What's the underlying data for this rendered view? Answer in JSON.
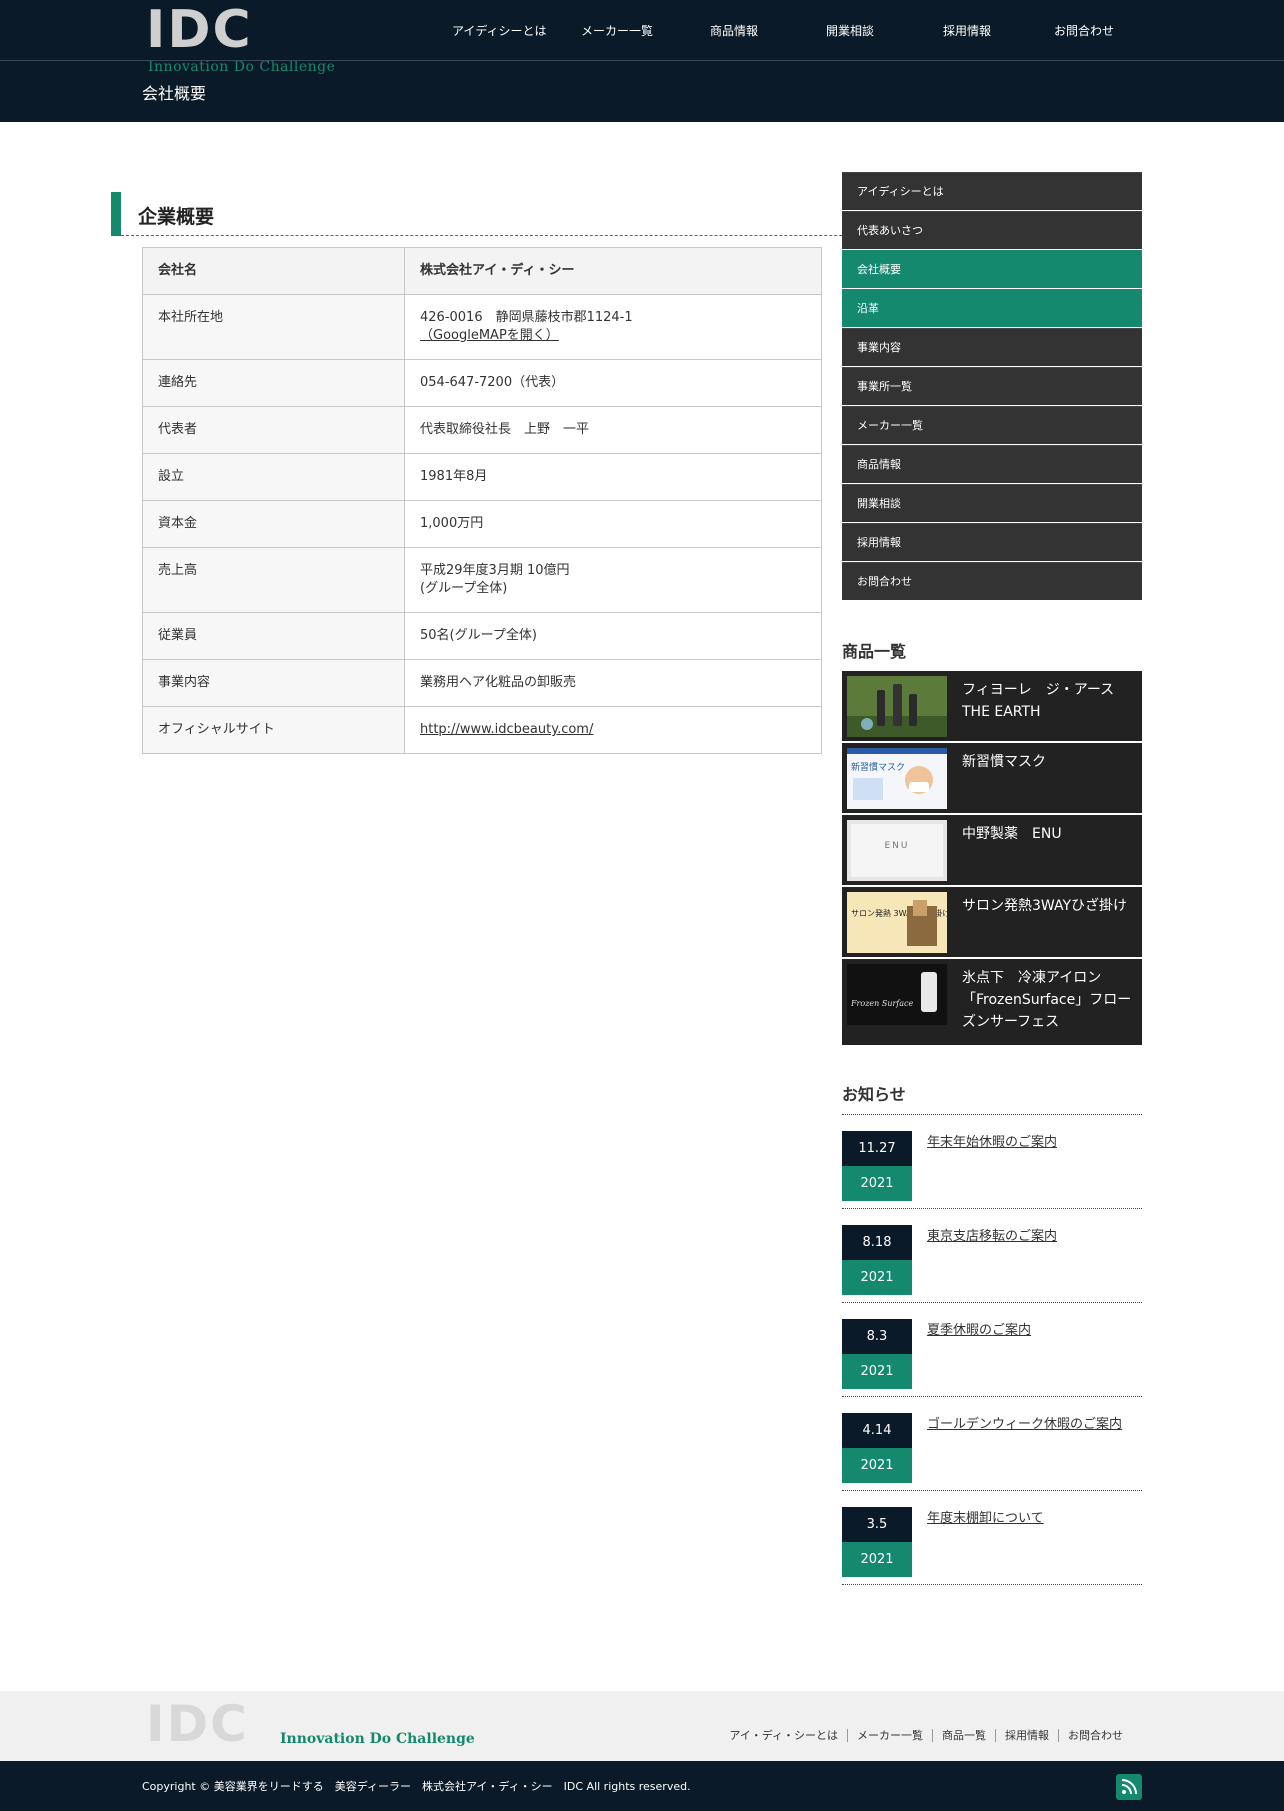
{
  "header": {
    "logo_text": "IDC",
    "logo_tagline": "Innovation Do Challenge",
    "nav": [
      "アイディシーとは",
      "メーカー一覧",
      "商品情報",
      "開業相談",
      "採用情報",
      "お問合わせ"
    ],
    "page_heading": "会社概要"
  },
  "main": {
    "section_title": "企業概要",
    "table": [
      {
        "key": "会社名",
        "value": "株式会社アイ・ディ・シー"
      },
      {
        "key": "本社所在地",
        "value": "426-0016　静岡県藤枝市郡1124-1",
        "link": "（GoogleMAPを開く）"
      },
      {
        "key": "連絡先",
        "value": "054-647-7200（代表）"
      },
      {
        "key": "代表者",
        "value": "代表取締役社長　上野　一平"
      },
      {
        "key": "設立",
        "value": "1981年8月"
      },
      {
        "key": "資本金",
        "value": "1,000万円"
      },
      {
        "key": "売上高",
        "value": "平成29年度3月期 10億円",
        "value2": "(グループ全体)"
      },
      {
        "key": "従業員",
        "value": "50名(グループ全体)"
      },
      {
        "key": "事業内容",
        "value": "業務用ヘア化粧品の卸販売"
      },
      {
        "key": "オフィシャルサイト",
        "link": "http://www.idcbeauty.com/"
      }
    ]
  },
  "sidebar": {
    "menu": [
      {
        "label": "アイディシーとは",
        "active": false
      },
      {
        "label": "代表あいさつ",
        "active": false
      },
      {
        "label": "会社概要",
        "active": true
      },
      {
        "label": "沿革",
        "active": true
      },
      {
        "label": "事業内容",
        "active": false
      },
      {
        "label": "事業所一覧",
        "active": false
      },
      {
        "label": "メーカー一覧",
        "active": false
      },
      {
        "label": "商品情報",
        "active": false
      },
      {
        "label": "開業相談",
        "active": false
      },
      {
        "label": "採用情報",
        "active": false
      },
      {
        "label": "お問合わせ",
        "active": false
      }
    ],
    "products_heading": "商品一覧",
    "products": [
      {
        "name": "フィヨーレ　ジ・アース THE EARTH",
        "thumb": "bottles-photo"
      },
      {
        "name": "新習慣マスク",
        "thumb": "mask-photo",
        "thumb_text": "新習慣マスク"
      },
      {
        "name": "中野製薬　ENU",
        "thumb": "enu-box-photo",
        "thumb_text": "ENU"
      },
      {
        "name": "サロン発熱3WAYひざ掛け",
        "thumb": "blanket-photo",
        "thumb_text": "サロン発熱 3WAY ひざ掛け"
      },
      {
        "name": "氷点下　冷凍アイロン「FrozenSurface」フローズンサーフェス",
        "thumb": "iron-photo",
        "thumb_text": "Frozen Surface"
      }
    ],
    "news_heading": "お知らせ",
    "news": [
      {
        "date": "11.27",
        "year": "2021",
        "title": "年末年始休暇のご案内"
      },
      {
        "date": "8.18",
        "year": "2021",
        "title": "東京支店移転のご案内"
      },
      {
        "date": "8.3",
        "year": "2021",
        "title": "夏季休暇のご案内"
      },
      {
        "date": "4.14",
        "year": "2021",
        "title": "ゴールデンウィーク休暇のご案内"
      },
      {
        "date": "3.5",
        "year": "2021",
        "title": "年度末棚卸について"
      }
    ]
  },
  "footer": {
    "logo_text": "IDC",
    "logo_tagline": "Innovation Do Challenge",
    "nav": [
      "アイ・ディ・シーとは",
      "メーカー一覧",
      "商品一覧",
      "採用情報",
      "お問合わせ"
    ],
    "copyright": "Copyright ©  美容業界をリードする　美容ディーラー　株式会社アイ・ディ・シー　IDC All rights reserved.",
    "rss_icon": "rss-icon"
  },
  "colors": {
    "brand_green": "#14896e",
    "header_navy": "#0b1a28",
    "menu_dark": "#333333"
  }
}
